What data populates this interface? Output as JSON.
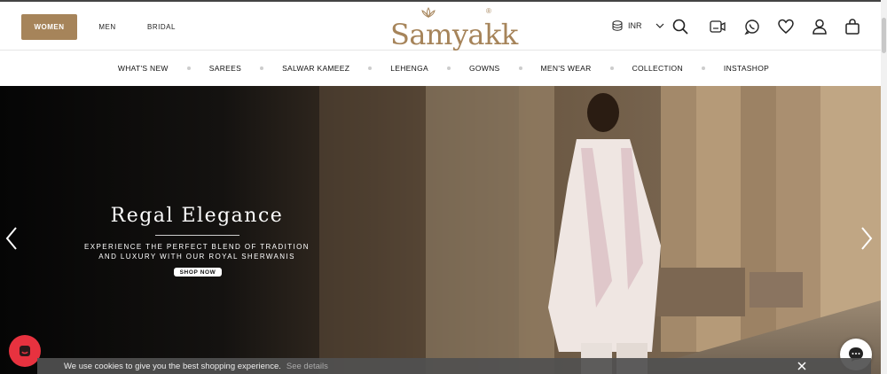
{
  "header": {
    "gender_tabs": [
      "WOMEN",
      "MEN",
      "BRIDAL"
    ],
    "logo_text": "Samyakk",
    "logo_reg": "®",
    "currency": "INR",
    "icons": [
      "currency-icon",
      "search-icon",
      "video-call-icon",
      "whatsapp-icon",
      "wishlist-heart-icon",
      "account-icon",
      "shopping-bag-icon"
    ]
  },
  "nav": {
    "items": [
      "WHAT'S NEW",
      "SAREES",
      "SALWAR KAMEEZ",
      "LEHENGA",
      "GOWNS",
      "MEN'S WEAR",
      "COLLECTION",
      "INSTASHOP"
    ]
  },
  "hero": {
    "title": "Regal Elegance",
    "subtitle_line1": "EXPERIENCE THE PERFECT BLEND OF TRADITION",
    "subtitle_line2": "AND LUXURY WITH OUR ROYAL SHERWANIS",
    "cta": "SHOP NOW"
  },
  "cookie": {
    "message": "We use cookies to give you the best shopping experience.",
    "link": "See details"
  },
  "colors": {
    "brand_gold": "#a6845a",
    "chat_red": "#e8323f"
  }
}
